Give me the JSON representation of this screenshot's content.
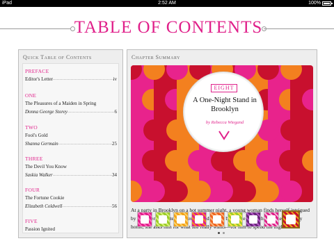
{
  "status_bar": {
    "device": "iPad",
    "time": "2:52 AM",
    "battery": "100%",
    "battery_level": 1.0
  },
  "header": {
    "title": "TABLE OF CONTENTS"
  },
  "quick_toc": {
    "heading": "Quick Table of Contents",
    "sections": [
      {
        "label": "PREFACE",
        "entries": [
          {
            "title": "Editor's Letter",
            "author": "",
            "page": "iv"
          }
        ]
      },
      {
        "label": "ONE",
        "entries": [
          {
            "title": "The Pleasures of a Maiden in Spring",
            "author": "",
            "page": ""
          },
          {
            "title": "",
            "author": "Donna George Storey",
            "page": "6"
          }
        ]
      },
      {
        "label": "TWO",
        "entries": [
          {
            "title": "Fool's Gold",
            "author": "",
            "page": ""
          },
          {
            "title": "",
            "author": "Shanna Germain",
            "page": "25"
          }
        ]
      },
      {
        "label": "THREE",
        "entries": [
          {
            "title": "The Devil You Know",
            "author": "",
            "page": ""
          },
          {
            "title": "",
            "author": "Saskia Walker",
            "page": "34"
          }
        ]
      },
      {
        "label": "FOUR",
        "entries": [
          {
            "title": "The Fortune Cookie",
            "author": "",
            "page": ""
          },
          {
            "title": "",
            "author": "Elizabeth Coldwell",
            "page": "56"
          }
        ]
      },
      {
        "label": "FIVE",
        "entries": [
          {
            "title": "Passion Ignited",
            "author": "",
            "page": ""
          }
        ]
      }
    ]
  },
  "chapter_summary": {
    "heading": "Chapter Summary",
    "number": "EIGHT",
    "title": "A One-Night Stand in Brooklyn",
    "author": "by Rebecca Wiegand",
    "text": "At a party in Brooklyn on a hot summer night, a young woman finds herself intrigued by a hipster DJ. After an evening of dancing, before he leaves her on their subway home, she asks him for what she really wants—for him to spend the night."
  },
  "thumbnails": [
    {
      "bg": "#e0208a",
      "accent": "#ff66bb"
    },
    {
      "bg": "#9ccc2a",
      "accent": "#d7f07a"
    },
    {
      "bg": "#f3a21b",
      "accent": "#fbd46b"
    },
    {
      "bg": "#e0208a",
      "accent": "#f88a1d"
    },
    {
      "bg": "#f0641e",
      "accent": "#f9b37a"
    },
    {
      "bg": "#9ccc2a",
      "accent": "#ffe14a"
    },
    {
      "bg": "#6a2a7a",
      "accent": "#b45ac8"
    },
    {
      "bg": "#e0208a",
      "accent": "#f4c0dc"
    },
    {
      "bg": "#c8102e",
      "accent": "#f0a81e",
      "selected": true
    }
  ],
  "pager": {
    "pages": 2,
    "current": 1
  },
  "colors": {
    "accent": "#e0208a",
    "cover_pink": "#e8238c",
    "cover_red": "#c8102e",
    "cover_orange": "#f3801f"
  }
}
